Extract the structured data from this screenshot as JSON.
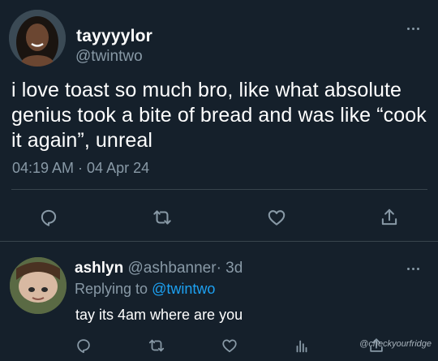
{
  "main_tweet": {
    "display_name": "tayyyylor",
    "handle": "@twintwo",
    "text": "i love toast so much bro, like what absolute genius took a bite of bread and was like “cook it again”, unreal",
    "timestamp": "04:19 AM · 04 Apr 24",
    "actions": [
      "reply-icon",
      "retweet-icon",
      "like-icon",
      "share-icon"
    ]
  },
  "reply": {
    "display_name": "ashlyn",
    "handle": "@ashbanner",
    "time": "· 3d",
    "replying_prefix": "Replying to ",
    "replying_to": "@twintwo",
    "text": "tay its 4am where are you",
    "actions": [
      "reply-icon",
      "retweet-icon",
      "like-icon",
      "analytics-icon",
      "share-icon"
    ]
  },
  "watermark": "@checkyourfridge",
  "colors": {
    "background": "#15202b",
    "text": "#ffffff",
    "muted": "#8899a6",
    "link": "#1da1f2",
    "divider": "#38444d"
  }
}
